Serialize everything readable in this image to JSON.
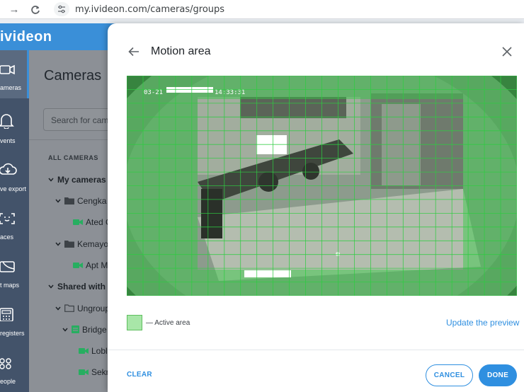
{
  "browser": {
    "url": "my.ivideon.com/cameras/groups"
  },
  "app": {
    "logo": "ivideon"
  },
  "rail": {
    "items": [
      {
        "label": "ameras",
        "icon": "camera-icon"
      },
      {
        "label": "vents",
        "icon": "bell-icon"
      },
      {
        "label": "ve export",
        "icon": "cloud-download-icon"
      },
      {
        "label": "aces",
        "icon": "face-scan-icon"
      },
      {
        "label": "t maps",
        "icon": "map-icon"
      },
      {
        "label": "registers",
        "icon": "register-icon"
      },
      {
        "label": "eople",
        "icon": "people-icon"
      }
    ]
  },
  "cameras": {
    "title": "Cameras",
    "search_placeholder": "Search for came",
    "all_cameras": "ALL CAMERAS",
    "tree": [
      {
        "label": "My cameras"
      },
      {
        "label": "Cengka"
      },
      {
        "label": "Ated C"
      },
      {
        "label": "Kemayo"
      },
      {
        "label": "Apt M"
      },
      {
        "label": "Shared with r"
      },
      {
        "label": "Ungroup"
      },
      {
        "label": "Bridge"
      },
      {
        "label": "Lobl"
      },
      {
        "label": "Sekr"
      }
    ]
  },
  "modal": {
    "title": "Motion area",
    "overlay_timestamp": "03-21",
    "overlay_time": "14:33:31",
    "legend_label": "— Active area",
    "update_preview": "Update the preview",
    "clear": "CLEAR",
    "cancel": "CANCEL",
    "done": "DONE",
    "grid": {
      "columns": 24,
      "rows": 16,
      "active_color": "#2ecc40"
    }
  }
}
